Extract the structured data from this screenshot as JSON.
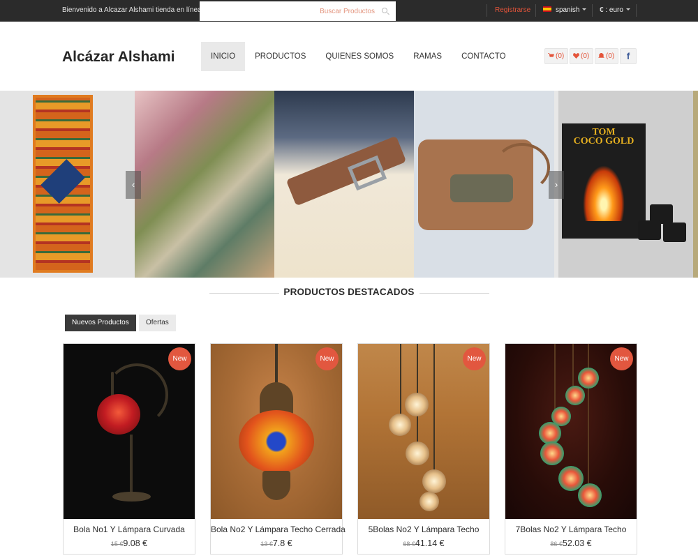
{
  "topbar": {
    "welcome": "Bienvenido a Alcazar Alshami tienda en línea !",
    "search_placeholder": "Buscar Productos",
    "register": "Registrarse",
    "language": "spanish",
    "currency": "€ : euro"
  },
  "header": {
    "logo": "Alcázar Alshami",
    "nav": [
      "INICIO",
      "PRODUCTOS",
      "QUIENES SOMOS",
      "RAMAS",
      "CONTACTO"
    ],
    "cart_count": "(0)",
    "wishlist_count": "(0)",
    "notifications_count": "(0)",
    "facebook": "f"
  },
  "slider": {
    "box_brand_top": "TOM",
    "box_brand_bottom": "COCO GOLD"
  },
  "featured": {
    "title": "PRODUCTOS DESTACADOS",
    "tabs": [
      "Nuevos Productos",
      "Ofertas"
    ],
    "products": [
      {
        "badge": "New",
        "name": "Bola No1 Y Lámpara Curvada",
        "old_price": "15 €",
        "price": "9.08 €"
      },
      {
        "badge": "New",
        "name": "Bola No2 Y Lámpara Techo Cerrada",
        "old_price": "13 €",
        "price": "7.8 €"
      },
      {
        "badge": "New",
        "name": "5Bolas No2 Y Lámpara Techo",
        "old_price": "68 €",
        "price": "41.14 €"
      },
      {
        "badge": "New",
        "name": "7Bolas No2 Y Lámpara Techo",
        "old_price": "86 €",
        "price": "52.03 €"
      }
    ]
  },
  "colors": {
    "accent": "#e4543a",
    "topbar_bg": "#2b2b2b",
    "badge": "#e2573f"
  }
}
